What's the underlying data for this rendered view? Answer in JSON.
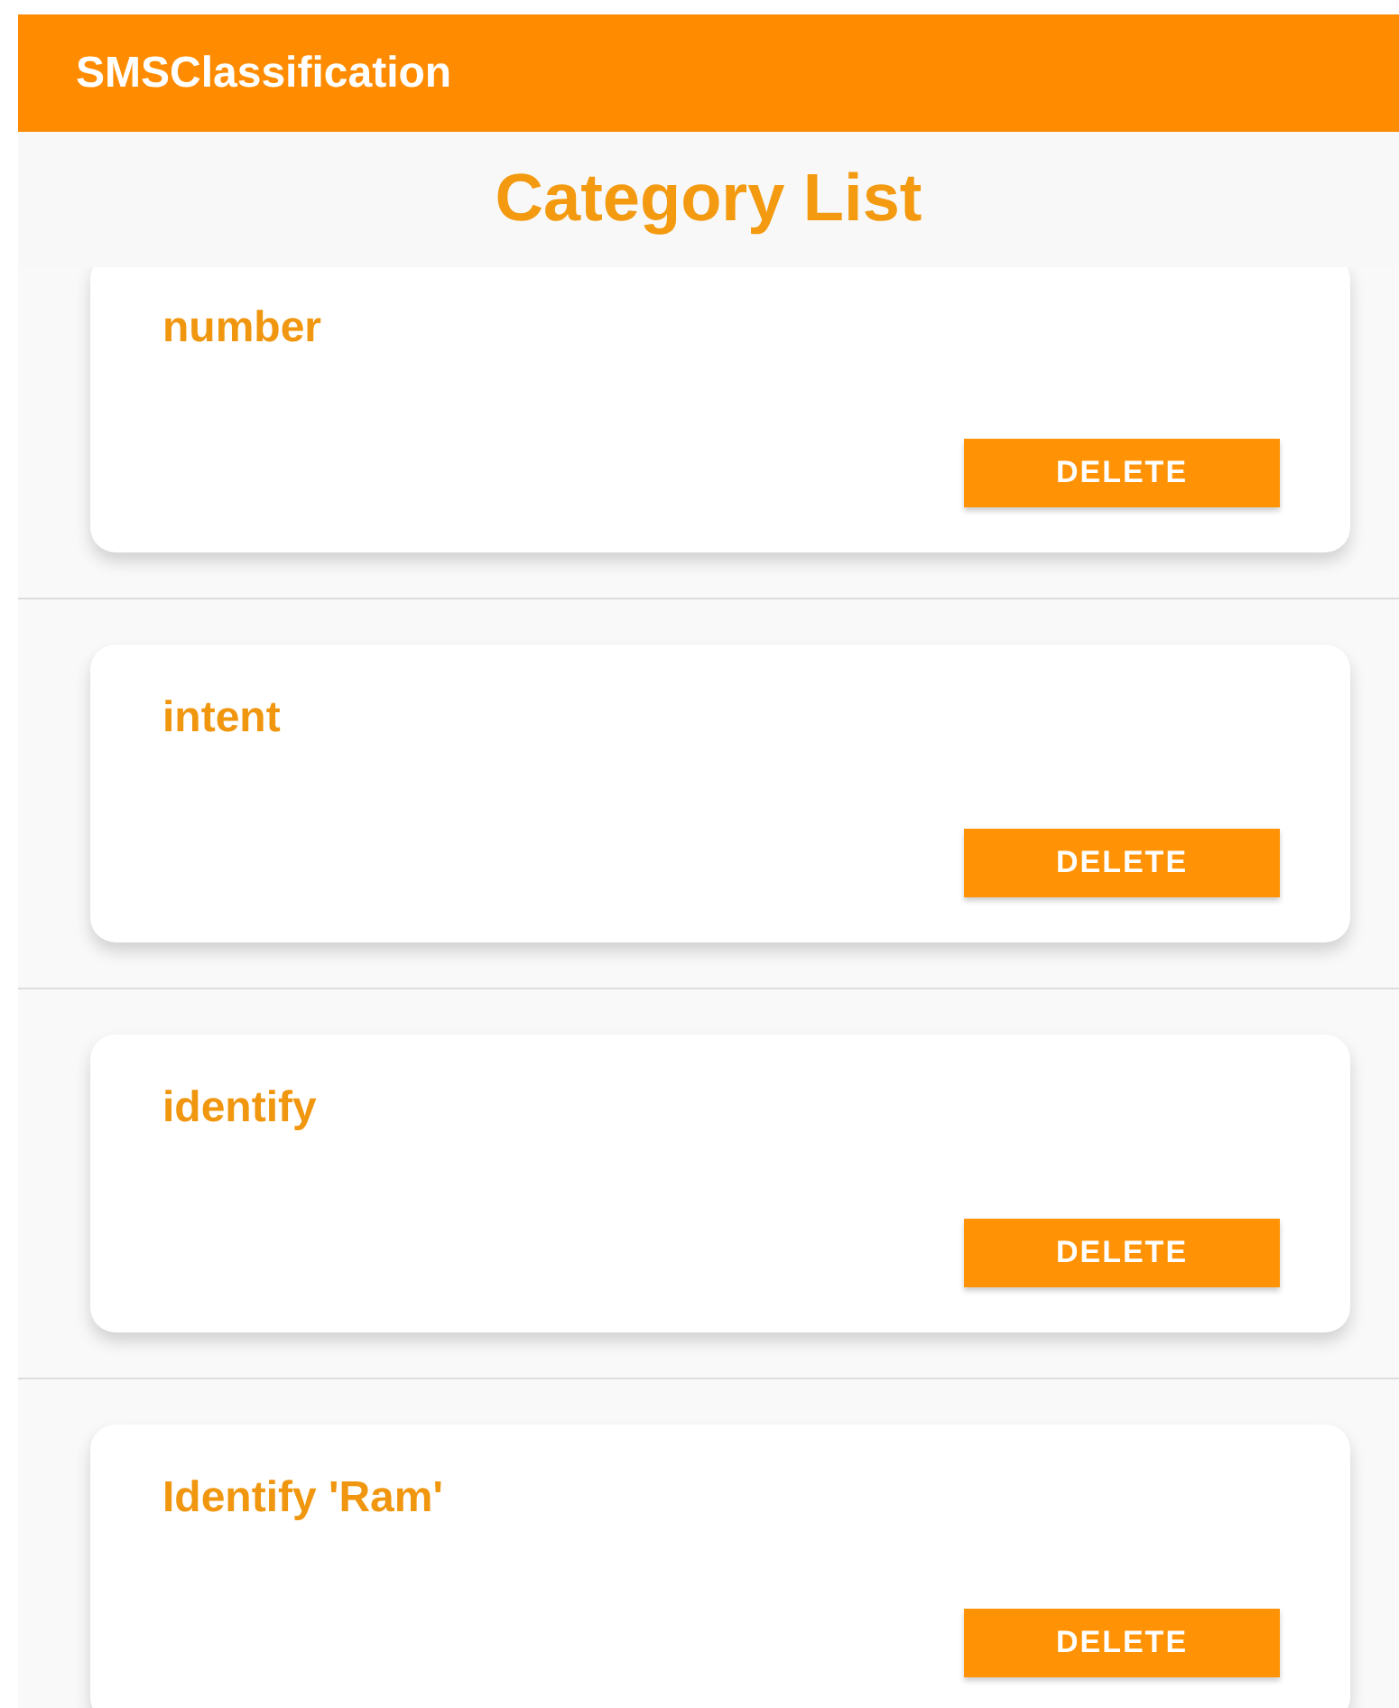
{
  "app_bar": {
    "title": "SMSClassification"
  },
  "heading": "Category List",
  "categories": [
    {
      "name": "number",
      "button": "DELETE"
    },
    {
      "name": "intent",
      "button": "DELETE"
    },
    {
      "name": "identify",
      "button": "DELETE"
    },
    {
      "name": "Identify 'Ram'",
      "button": "DELETE"
    }
  ]
}
